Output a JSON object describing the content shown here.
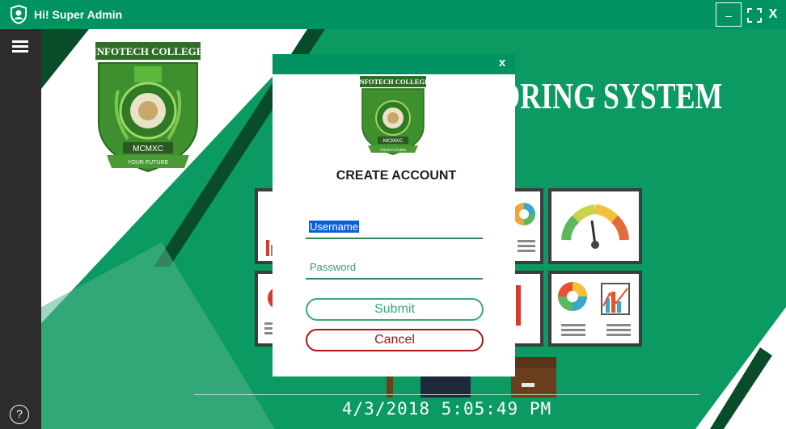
{
  "window": {
    "title": "Hi! Super Admin",
    "min_label": "–",
    "close_label": "X"
  },
  "sidebar": {
    "help_label": "?"
  },
  "background": {
    "heading": "TORING SYSTEM",
    "datetime": "4/3/2018 5:05:49 PM"
  },
  "logo": {
    "college_name": "INFOTECH COLLEGE",
    "motto": "MCMXC",
    "tagline": "YOUR FUTURE"
  },
  "modal": {
    "close_label": "x",
    "title": "CREATE ACCOUNT",
    "username_value": "Username",
    "password_placeholder": "Password",
    "submit_label": "Submit",
    "cancel_label": "Cancel"
  },
  "colors": {
    "brand_green": "#009260",
    "sidebar_dark": "#2c2c2c",
    "cancel_red": "#a21818"
  }
}
